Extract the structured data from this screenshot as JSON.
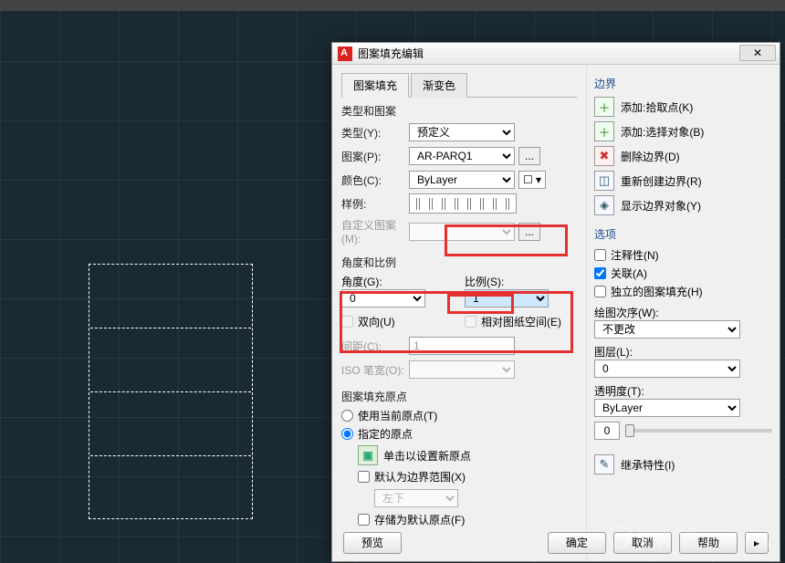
{
  "dialog": {
    "title": "图案填充编辑",
    "tabs": {
      "hatch": "图案填充",
      "gradient": "渐变色"
    },
    "typePattern": {
      "group": "类型和图案",
      "type_lbl": "类型(Y):",
      "type_val": "预定义",
      "pattern_lbl": "图案(P):",
      "pattern_val": "AR-PARQ1",
      "color_lbl": "颜色(C):",
      "color_val": "ByLayer",
      "sample_lbl": "样例:",
      "custom_lbl": "自定义图案(M):"
    },
    "angleScale": {
      "group": "角度和比例",
      "angle_lbl": "角度(G):",
      "angle_val": "0",
      "scale_lbl": "比例(S):",
      "scale_val": "1",
      "double_lbl": "双向(U)",
      "paper_lbl": "相对图纸空间(E)",
      "spacing_lbl": "间距(C):",
      "spacing_val": "1",
      "iso_lbl": "ISO 笔宽(O):"
    },
    "origin": {
      "group": "图案填充原点",
      "use_current": "使用当前原点(T)",
      "specified": "指定的原点",
      "click_new": "单击以设置新原点",
      "default_ext": "默认为边界范围(X)",
      "pos_val": "左下",
      "store": "存储为默认原点(F)"
    },
    "boundary": {
      "group": "边界",
      "add_pick": "添加:拾取点(K)",
      "add_select": "添加:选择对象(B)",
      "del": "删除边界(D)",
      "recreate": "重新创建边界(R)",
      "show": "显示边界对象(Y)"
    },
    "options": {
      "group": "选项",
      "annotative": "注释性(N)",
      "assoc": "关联(A)",
      "separate": "独立的图案填充(H)",
      "draworder_lbl": "绘图次序(W):",
      "draworder_val": "不更改",
      "layer_lbl": "图层(L):",
      "layer_val": "0",
      "trans_lbl": "透明度(T):",
      "trans_val": "ByLayer",
      "trans_num": "0",
      "inherit": "继承特性(I)"
    },
    "buttons": {
      "preview": "预览",
      "ok": "确定",
      "cancel": "取消",
      "help": "帮助"
    }
  },
  "watermark": {
    "brand": "Baidu",
    "sub": "经验",
    "url": "jingyan.baidu.com"
  }
}
